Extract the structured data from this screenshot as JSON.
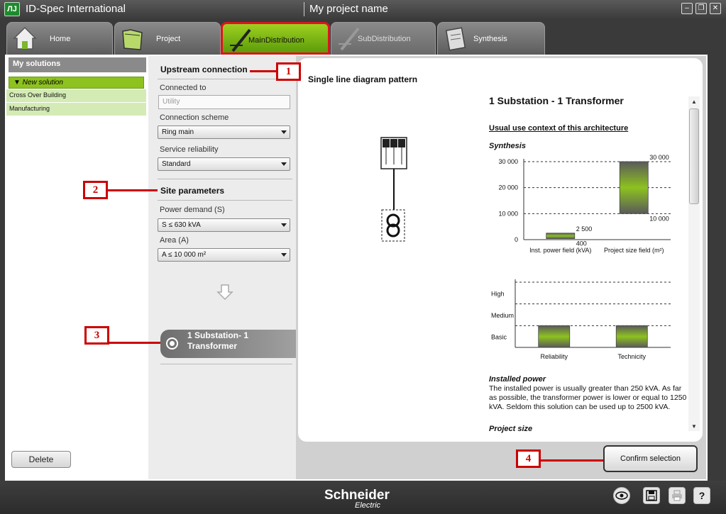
{
  "window": {
    "app_title": "ID-Spec International",
    "app_logo_text": "ЛЈ",
    "project_name": "My project name"
  },
  "tabs": [
    {
      "label": "Home",
      "icon": "house-icon"
    },
    {
      "label": "Project",
      "icon": "folder-icon"
    },
    {
      "label": "MainDistribution",
      "icon": "pen-icon",
      "active": true
    },
    {
      "label": "SubDistribution",
      "icon": "pen-icon"
    },
    {
      "label": "Synthesis",
      "icon": "notebook-icon"
    }
  ],
  "sidebar": {
    "heading": "My solutions",
    "new_solution": "▼ New solution",
    "items": [
      "Cross Over Building",
      "Manufacturing"
    ],
    "delete_label": "Delete"
  },
  "upstream": {
    "heading": "Upstream connection",
    "connected_to_label": "Connected to",
    "connected_to_placeholder": "Utility",
    "scheme_label": "Connection scheme",
    "scheme_value": "Ring main",
    "reliability_label": "Service reliability",
    "reliability_value": "Standard"
  },
  "site": {
    "heading": "Site parameters",
    "power_label": "Power demand (S)",
    "power_value": "S ≤ 630 kVA",
    "area_label": "Area (A)",
    "area_value": "A ≤ 10 000 m²"
  },
  "result": {
    "label_line1": "1 Substation- 1",
    "label_line2": "Transformer"
  },
  "details": {
    "sld_title": "Single line diagram pattern",
    "arch_title": "1 Substation - 1 Transformer",
    "usual_context": "Usual use context of this architecture",
    "synthesis": "Synthesis",
    "installed_power_head": "Installed power",
    "installed_power_text": "The installed power is usually greater than 250 kVA. As far as possible, the transformer power is lower or equal to 1250 kVA. Seldom this solution can be used up to 2500 kVA.",
    "project_size_head": "Project size"
  },
  "confirm_label": "Confirm selection",
  "brand": {
    "name": "Schneider",
    "sub": "Electric"
  },
  "footer_icons": [
    "eye-icon",
    "save-icon",
    "print-icon",
    "help-icon"
  ],
  "help_glyph": "?",
  "callouts": [
    "1",
    "2",
    "3",
    "4"
  ],
  "colors": {
    "accent_green": "#8dc21f",
    "callout_red": "#cc0000",
    "bar_gradient_top": "#8dc21f",
    "bar_gradient_bottom": "#5a5a5a"
  },
  "chart_data": [
    {
      "type": "bar",
      "categories": [
        "Inst. power field (kVA)",
        "Project size field (m²)"
      ],
      "ranges": [
        [
          400,
          2500
        ],
        [
          10000,
          30000
        ]
      ],
      "range_labels": [
        [
          "400",
          "2 500"
        ],
        [
          "10 000",
          "30 000"
        ]
      ],
      "yticks": [
        "0",
        "10 000",
        "20 000",
        "30 000"
      ],
      "ylim": [
        0,
        30000
      ],
      "grid": true
    },
    {
      "type": "bar",
      "categories": [
        "Reliability",
        "Technicity"
      ],
      "levels": [
        "Basic",
        "Medium",
        "High"
      ],
      "values": [
        "Basic",
        "Basic"
      ],
      "grid": true
    }
  ]
}
